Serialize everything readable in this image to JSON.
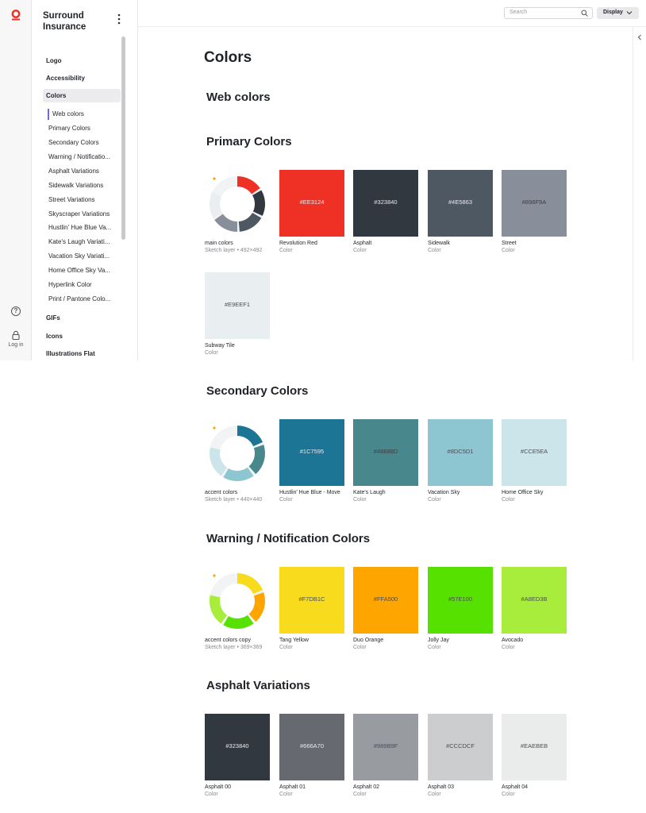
{
  "app": {
    "brand": "Surround Insurance",
    "login_label": "Log in",
    "help_glyph": "?",
    "search_placeholder": "Search",
    "display_label": "Display"
  },
  "sidebar": {
    "top_items": [
      {
        "label": "Logo"
      },
      {
        "label": "Accessibility"
      },
      {
        "label": "Colors"
      }
    ],
    "color_items": [
      "Web colors",
      "Primary Colors",
      "Secondary Colors",
      "Warning / Notificatio...",
      "Asphalt Variations",
      "Sidewalk Variations",
      "Street Variations",
      "Skyscraper Variations",
      "Hustlin' Hue Blue Va...",
      "Kate's Laugh Variati...",
      "Vacation Sky Variati...",
      "Home Office Sky Va...",
      "Hyperlink Color",
      "Print / Pantone Colo..."
    ],
    "bottom_items": [
      "GIFs",
      "Icons",
      "Illustrations Flat"
    ]
  },
  "page": {
    "title": "Colors",
    "web_colors_heading": "Web colors",
    "sections": [
      {
        "heading": "Primary Colors",
        "layer": {
          "name": "main colors",
          "meta": "Sketch layer • 492×492"
        },
        "swatches": [
          {
            "hex": "#EE3124",
            "name": "Revolution Red",
            "kind": "Color"
          },
          {
            "hex": "#323840",
            "name": "Asphalt",
            "kind": "Color"
          },
          {
            "hex": "#4E5863",
            "name": "Sidewalk",
            "kind": "Color"
          },
          {
            "hex": "#898F9A",
            "name": "Street",
            "kind": "Color"
          },
          {
            "hex": "#E9EEF1",
            "name": "Subway Tile",
            "kind": "Color"
          }
        ]
      },
      {
        "heading": "Secondary Colors",
        "layer": {
          "name": "accent colors",
          "meta": "Sketch layer • 440×440"
        },
        "swatches": [
          {
            "hex": "#1C7595",
            "name": "Hustlin' Hue Blue - Move",
            "kind": "Color"
          },
          {
            "hex": "#48888D",
            "name": "Kate's Laugh",
            "kind": "Color"
          },
          {
            "hex": "#8DC5D1",
            "name": "Vacation Sky",
            "kind": "Color"
          },
          {
            "hex": "#CCE5EA",
            "name": "Home Office Sky",
            "kind": "Color"
          }
        ]
      },
      {
        "heading": "Warning / Notification Colors",
        "layer": {
          "name": "accent colors copy",
          "meta": "Sketch layer • 369×369"
        },
        "swatches": [
          {
            "hex": "#F7DB1C",
            "name": "Tang Yellow",
            "kind": "Color"
          },
          {
            "hex": "#FFA500",
            "name": "Duo Orange",
            "kind": "Color"
          },
          {
            "hex": "#57E100",
            "name": "Jolly Jay",
            "kind": "Color"
          },
          {
            "hex": "#A8ED3B",
            "name": "Avocado",
            "kind": "Color"
          }
        ]
      },
      {
        "heading": "Asphalt Variations",
        "swatches": [
          {
            "hex": "#323840",
            "name": "Asphalt 00",
            "kind": "Color"
          },
          {
            "hex": "#666A70",
            "name": "Asphalt 01",
            "kind": "Color"
          },
          {
            "hex": "#989B9F",
            "name": "Asphalt 02",
            "kind": "Color"
          },
          {
            "hex": "#CCCDCF",
            "name": "Asphalt 03",
            "kind": "Color"
          },
          {
            "hex": "#EAEBEB",
            "name": "Asphalt 04",
            "kind": "Color"
          }
        ]
      }
    ]
  },
  "colors": {
    "brand_red": "#EE3124",
    "accent_marker": "#F7A800"
  }
}
